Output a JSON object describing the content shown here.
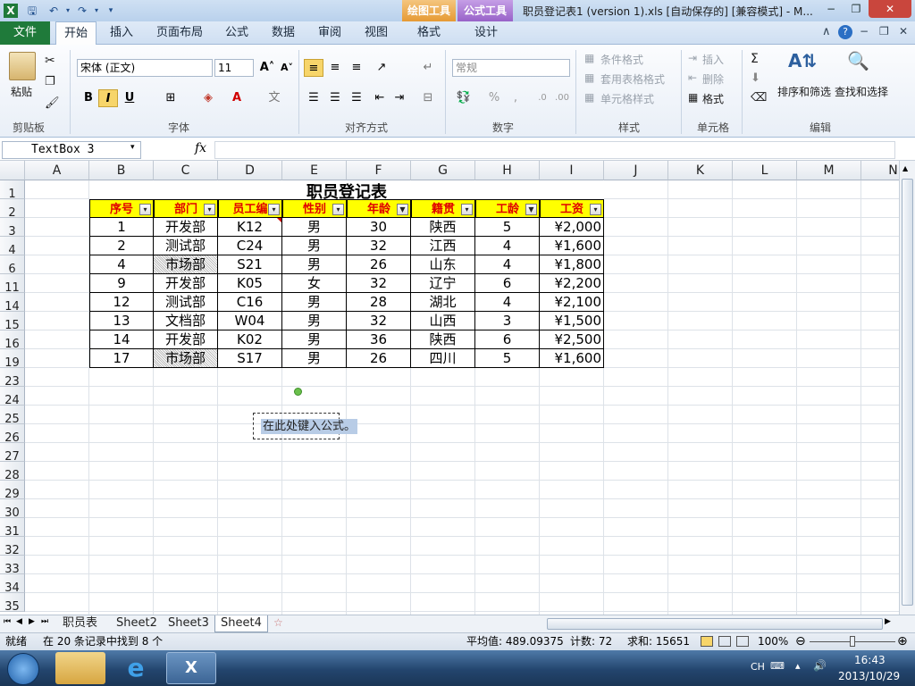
{
  "title_bar": {
    "context_drawing": "绘图工具",
    "context_formula": "公式工具",
    "window_title": "职员登记表1 (version 1).xls [自动保存的] [兼容模式] - M..."
  },
  "tabs": {
    "file": "文件",
    "items": [
      "开始",
      "插入",
      "页面布局",
      "公式",
      "数据",
      "审阅",
      "视图",
      "格式",
      "设计"
    ]
  },
  "ribbon": {
    "clipboard": {
      "paste": "粘贴",
      "label": "剪贴板"
    },
    "font": {
      "name": "宋体 (正文)",
      "size": "11",
      "label": "字体",
      "bold": "B",
      "italic": "I",
      "underline": "U"
    },
    "alignment": {
      "label": "对齐方式"
    },
    "number": {
      "format": "常规",
      "label": "数字",
      "percent": "%",
      "comma": ","
    },
    "styles": {
      "conditional": "条件格式",
      "table": "套用表格格式",
      "cell": "单元格样式",
      "label": "样式"
    },
    "cells": {
      "insert": "插入",
      "delete": "删除",
      "format": "格式",
      "label": "单元格"
    },
    "editing": {
      "sort": "排序和筛选",
      "find": "查找和选择",
      "label": "编辑"
    }
  },
  "formula_bar": {
    "name_box": "TextBox 3",
    "fx": "fx",
    "formula": ""
  },
  "columns": [
    "A",
    "B",
    "C",
    "D",
    "E",
    "F",
    "G",
    "H",
    "I",
    "J",
    "K",
    "L",
    "M",
    "N"
  ],
  "rows": [
    "1",
    "2",
    "3",
    "4",
    "6",
    "11",
    "14",
    "15",
    "16",
    "19",
    "23",
    "24",
    "25",
    "26",
    "27",
    "28",
    "29",
    "30",
    "31",
    "32",
    "33",
    "34",
    "35"
  ],
  "sheet": {
    "title": "职员登记表",
    "headers": [
      "序号",
      "部门",
      "员工编",
      "性别",
      "年龄",
      "籍贯",
      "工龄",
      "工资"
    ],
    "data": [
      [
        "1",
        "开发部",
        "K12",
        "男",
        "30",
        "陕西",
        "5",
        "¥2,000"
      ],
      [
        "2",
        "测试部",
        "C24",
        "男",
        "32",
        "江西",
        "4",
        "¥1,600"
      ],
      [
        "4",
        "市场部",
        "S21",
        "男",
        "26",
        "山东",
        "4",
        "¥1,800"
      ],
      [
        "9",
        "开发部",
        "K05",
        "女",
        "32",
        "辽宁",
        "6",
        "¥2,200"
      ],
      [
        "12",
        "测试部",
        "C16",
        "男",
        "28",
        "湖北",
        "4",
        "¥2,100"
      ],
      [
        "13",
        "文档部",
        "W04",
        "男",
        "32",
        "山西",
        "3",
        "¥1,500"
      ],
      [
        "14",
        "开发部",
        "K02",
        "男",
        "36",
        "陕西",
        "6",
        "¥2,500"
      ],
      [
        "17",
        "市场部",
        "S17",
        "男",
        "26",
        "四川",
        "5",
        "¥1,600"
      ]
    ]
  },
  "textbox": {
    "placeholder": "在此处键入公式。"
  },
  "sheet_tabs": [
    "职员表",
    "Sheet2",
    "Sheet3",
    "Sheet4"
  ],
  "active_sheet": "Sheet4",
  "status": {
    "ready": "就绪",
    "filter_info": "在 20 条记录中找到 8 个",
    "average": "平均值: 489.09375",
    "count": "计数: 72",
    "sum": "求和: 15651",
    "zoom": "100%"
  },
  "taskbar": {
    "lang": "CH",
    "time": "16:43",
    "date": "2013/10/29"
  }
}
